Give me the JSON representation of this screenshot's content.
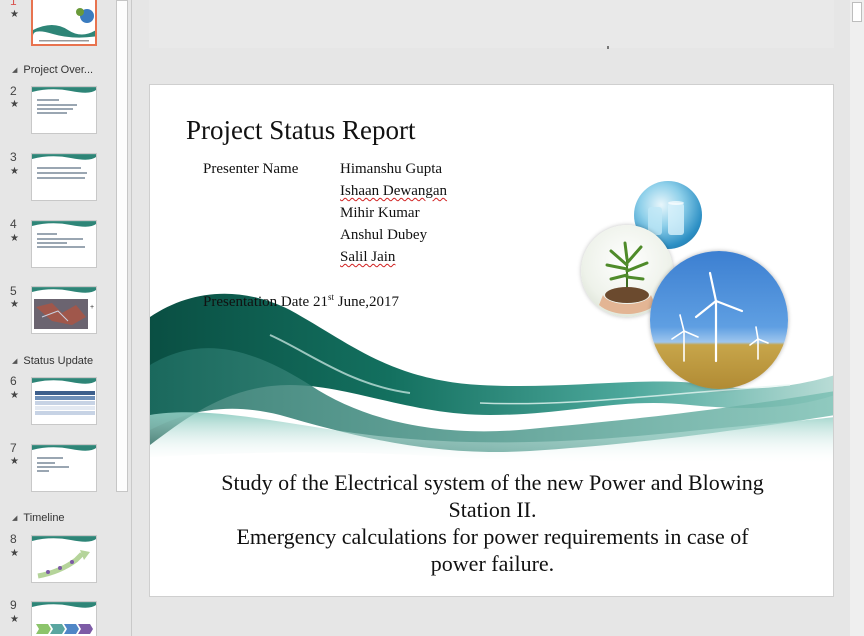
{
  "thumbnails": [
    {
      "number": "1",
      "selected": true
    },
    {
      "number": "2"
    },
    {
      "number": "3"
    },
    {
      "number": "4"
    },
    {
      "number": "5"
    },
    {
      "number": "6"
    },
    {
      "number": "7"
    },
    {
      "number": "8"
    },
    {
      "number": "9"
    }
  ],
  "sections": [
    {
      "label": "Project Over..."
    },
    {
      "label": "Status Update"
    },
    {
      "label": "Timeline"
    }
  ],
  "slide": {
    "title": "Project Status Report",
    "presenter_label": "Presenter Name",
    "presenters": [
      "Himanshu Gupta",
      "Ishaan Dewangan",
      "Mihir Kumar",
      "Anshul Dubey",
      "Salil Jain"
    ],
    "date_prefix": "Presentation Date 21",
    "date_sup": "st",
    "date_suffix": " June,2017",
    "subtitle_line1": "Study of the Electrical system of the new Power and Blowing",
    "subtitle_line2": "Station II.",
    "subtitle_line3": "Emergency calculations for power requirements in case of",
    "subtitle_line4": "power failure."
  },
  "colors": {
    "accent_selected": "#e8734f",
    "wave_dark": "#0b5a4a",
    "wave_light": "#5fb3a7"
  }
}
